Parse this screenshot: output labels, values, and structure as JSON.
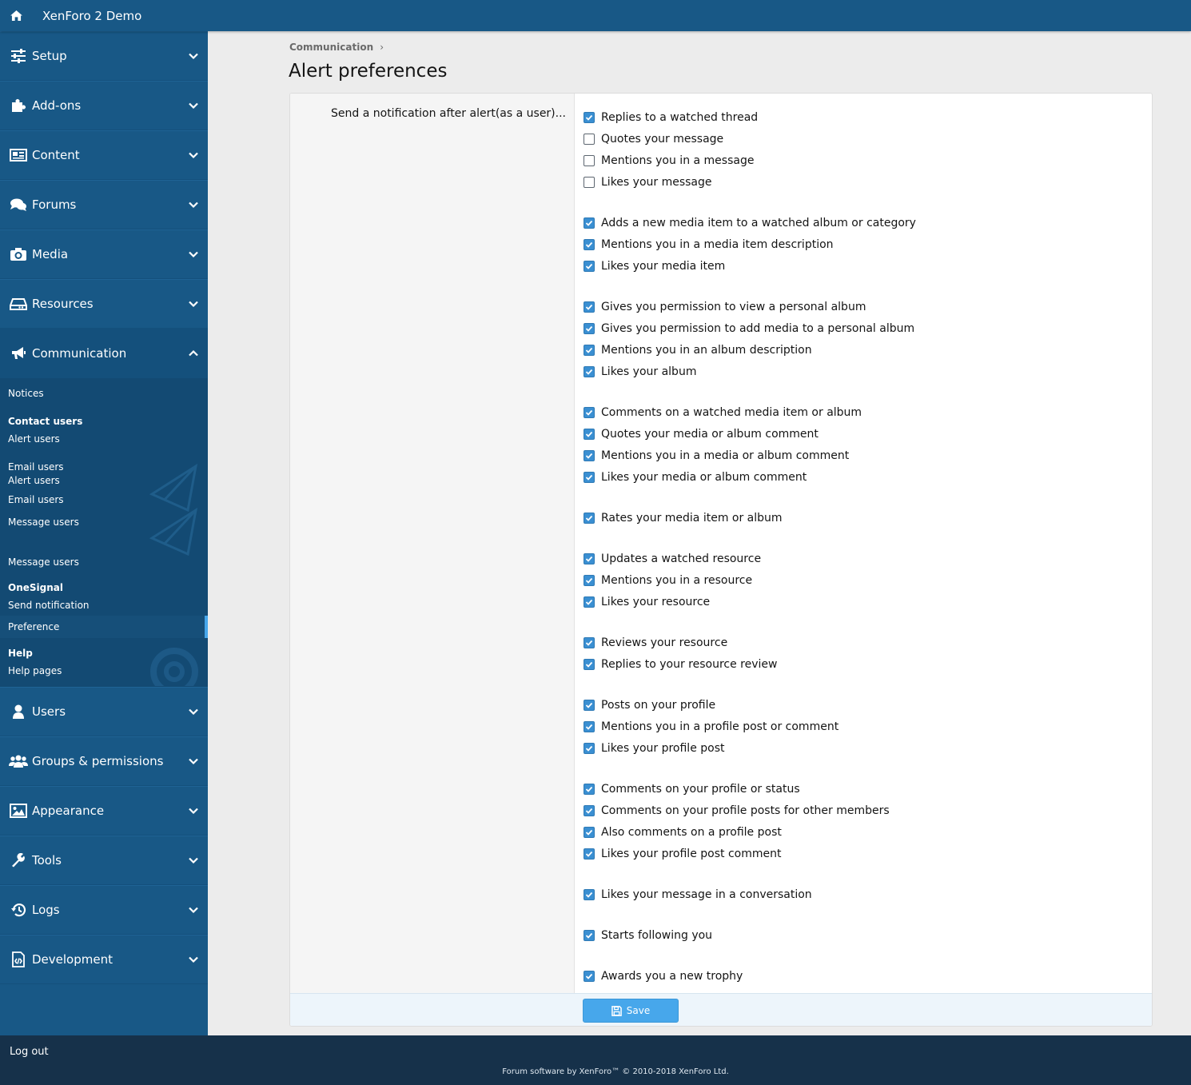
{
  "app": {
    "title": "XenForo 2 Demo"
  },
  "sidebar": {
    "sections_top": [
      {
        "label": "Setup",
        "icon": "sliders-icon"
      },
      {
        "label": "Add-ons",
        "icon": "puzzle-icon"
      },
      {
        "label": "Content",
        "icon": "newspaper-icon"
      },
      {
        "label": "Forums",
        "icon": "comments-icon"
      },
      {
        "label": "Media",
        "icon": "camera-icon"
      },
      {
        "label": "Resources",
        "icon": "hdd-icon"
      }
    ],
    "open_section": {
      "label": "Communication",
      "icon": "megaphone-icon",
      "items": {
        "notices": "Notices",
        "contact_head": "Contact users",
        "alert_users_1": "Alert users",
        "email_users_1": "Email users",
        "alert_users_2": "Alert users",
        "email_users_2": "Email users",
        "message_users_1": "Message users",
        "message_users_2": "Message users",
        "onesignal_head": "OneSignal",
        "send_notification": "Send notification",
        "preference": "Preference",
        "help_head": "Help",
        "help_pages": "Help pages"
      }
    },
    "sections_bottom": [
      {
        "label": "Users",
        "icon": "user-icon"
      },
      {
        "label": "Groups & permissions",
        "icon": "users-icon"
      },
      {
        "label": "Appearance",
        "icon": "image-icon"
      },
      {
        "label": "Tools",
        "icon": "wrench-icon"
      },
      {
        "label": "Logs",
        "icon": "history-icon"
      },
      {
        "label": "Development",
        "icon": "code-file-icon"
      }
    ]
  },
  "breadcrumb": {
    "item": "Communication",
    "sep": "›"
  },
  "page": {
    "title": "Alert preferences"
  },
  "form": {
    "label": "Send a notification after alert(as a user)...",
    "save_label": "Save",
    "groups": [
      [
        {
          "label": "Replies to a watched thread",
          "checked": true
        },
        {
          "label": "Quotes your message",
          "checked": false
        },
        {
          "label": "Mentions you in a message",
          "checked": false
        },
        {
          "label": "Likes your message",
          "checked": false
        }
      ],
      [
        {
          "label": "Adds a new media item to a watched album or category",
          "checked": true
        },
        {
          "label": "Mentions you in a media item description",
          "checked": true
        },
        {
          "label": "Likes your media item",
          "checked": true
        }
      ],
      [
        {
          "label": "Gives you permission to view a personal album",
          "checked": true
        },
        {
          "label": "Gives you permission to add media to a personal album",
          "checked": true
        },
        {
          "label": "Mentions you in an album description",
          "checked": true
        },
        {
          "label": "Likes your album",
          "checked": true
        }
      ],
      [
        {
          "label": "Comments on a watched media item or album",
          "checked": true
        },
        {
          "label": "Quotes your media or album comment",
          "checked": true
        },
        {
          "label": "Mentions you in a media or album comment",
          "checked": true
        },
        {
          "label": "Likes your media or album comment",
          "checked": true
        }
      ],
      [
        {
          "label": "Rates your media item or album",
          "checked": true
        }
      ],
      [
        {
          "label": "Updates a watched resource",
          "checked": true
        },
        {
          "label": "Mentions you in a resource",
          "checked": true
        },
        {
          "label": "Likes your resource",
          "checked": true
        }
      ],
      [
        {
          "label": "Reviews your resource",
          "checked": true
        },
        {
          "label": "Replies to your resource review",
          "checked": true
        }
      ],
      [
        {
          "label": "Posts on your profile",
          "checked": true
        },
        {
          "label": "Mentions you in a profile post or comment",
          "checked": true
        },
        {
          "label": "Likes your profile post",
          "checked": true
        }
      ],
      [
        {
          "label": "Comments on your profile or status",
          "checked": true
        },
        {
          "label": "Comments on your profile posts for other members",
          "checked": true
        },
        {
          "label": "Also comments on a profile post",
          "checked": true
        },
        {
          "label": "Likes your profile post comment",
          "checked": true
        }
      ],
      [
        {
          "label": "Likes your message in a conversation",
          "checked": true
        }
      ],
      [
        {
          "label": "Starts following you",
          "checked": true
        }
      ],
      [
        {
          "label": "Awards you a new trophy",
          "checked": true
        }
      ]
    ]
  },
  "footer": {
    "logout": "Log out",
    "copyright": "Forum software by XenForo™ © 2010-2018 XenForo Ltd."
  },
  "colors": {
    "header": "#185886",
    "accent": "#47a7eb",
    "footer": "#16314a",
    "checkbox": "#3a8fd2"
  }
}
